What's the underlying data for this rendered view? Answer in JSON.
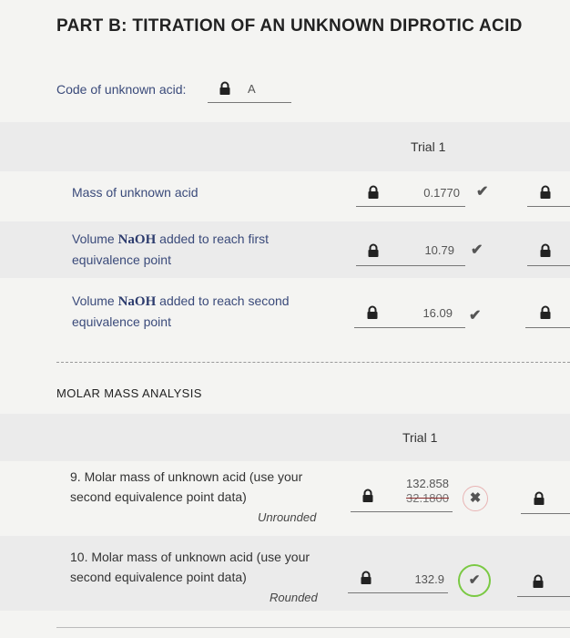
{
  "title": "PART B: TITRATION OF AN UNKNOWN DIPROTIC ACID",
  "code": {
    "label": "Code of unknown acid:",
    "value": "A"
  },
  "titration": {
    "column_header": "Trial 1",
    "rows": [
      {
        "label_plain": "Mass of unknown acid",
        "value": "0.1770",
        "status": "correct"
      },
      {
        "label_pre": "Volume ",
        "label_bold": "NaOH",
        "label_post": " added to reach first",
        "label_line2": "equivalence point",
        "value": "10.79",
        "status": "correct"
      },
      {
        "label_pre": "Volume ",
        "label_bold": "NaOH",
        "label_post": " added to reach second",
        "label_line2": "equivalence point",
        "value": "16.09",
        "status": "correct"
      }
    ]
  },
  "molar": {
    "section_title": "MOLAR MASS ANALYSIS",
    "column_header": "Trial 1",
    "rows": [
      {
        "line1": "9. Molar mass of unknown acid (use your",
        "line2": "second equivalence point data)",
        "note": "Unrounded",
        "value": "132.858",
        "old_value": "32.1800",
        "status": "incorrect"
      },
      {
        "line1": "10. Molar mass of unknown acid (use your",
        "line2": "second equivalence point data)",
        "note": "Rounded",
        "value": "132.9",
        "status": "correct"
      }
    ]
  },
  "icons": {
    "correct": "check-icon",
    "incorrect": "x-icon",
    "lock": "lock-icon"
  },
  "colors": {
    "label": "#3a4a7a",
    "correct_ring": "#7ac943",
    "incorrect_ring": "#e8b4b4"
  }
}
